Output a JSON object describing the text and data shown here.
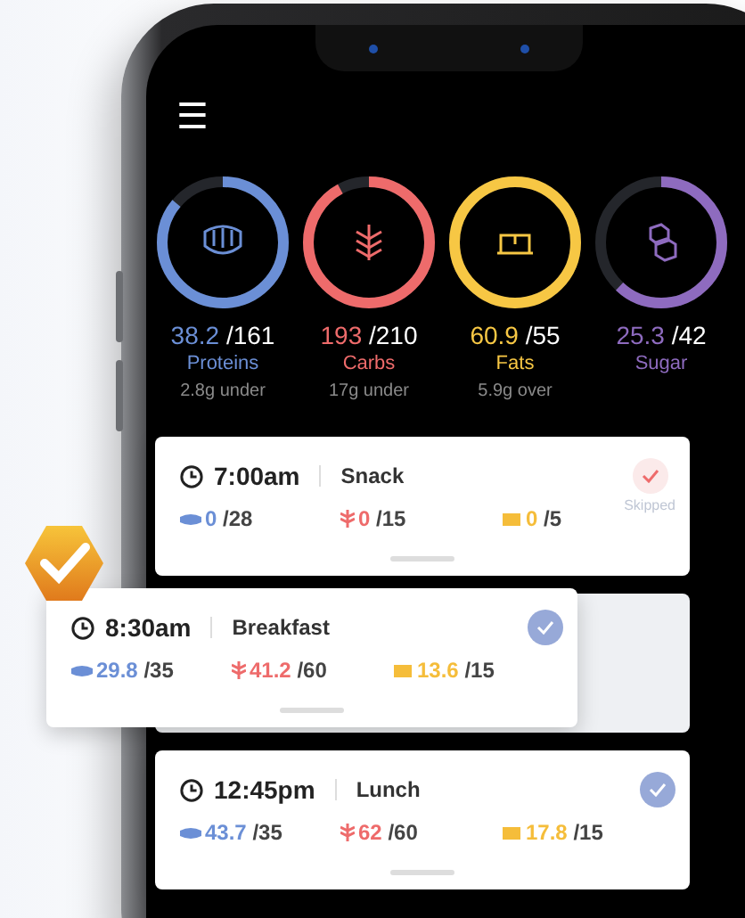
{
  "menu": {
    "label": "☰"
  },
  "macros": [
    {
      "kind": "protein",
      "value": "38.2",
      "goal": "/161",
      "name": "Proteins",
      "note": "2.8g under",
      "level": 0.86,
      "color": "#6b8fd6"
    },
    {
      "kind": "carbs",
      "value": "193",
      "goal": "/210",
      "name": "Carbs",
      "note": "17g under",
      "level": 0.92,
      "color": "#ee6b6b"
    },
    {
      "kind": "fat",
      "value": "60.9",
      "goal": "/55",
      "name": "Fats",
      "note": "5.9g over",
      "level": 1,
      "color": "#f7c744"
    },
    {
      "kind": "sugar",
      "value": "25.3",
      "goal": "/42",
      "name": "Sugar",
      "level": 0.62,
      "color": "#8e6bbf"
    }
  ],
  "meals": [
    {
      "time": "7:00am",
      "name": "Snack",
      "checked": true,
      "skipped": true,
      "status_label": "Skipped",
      "popped": false,
      "amounts": [
        {
          "kind": "protein",
          "value": "0",
          "goal": "/28"
        },
        {
          "kind": "carbs",
          "value": "0",
          "goal": "/15"
        },
        {
          "kind": "fat",
          "value": "0",
          "goal": "/5"
        }
      ]
    },
    {
      "time": "8:30am",
      "name": "Breakfast",
      "checked": true,
      "skipped": false,
      "popped": true,
      "amounts": [
        {
          "kind": "protein",
          "value": "29.8",
          "goal": "/35"
        },
        {
          "kind": "carbs",
          "value": "41.2",
          "goal": "/60"
        },
        {
          "kind": "fat",
          "value": "13.6",
          "goal": "/15"
        }
      ]
    },
    {
      "time": "12:45pm",
      "name": "Lunch",
      "checked": true,
      "skipped": false,
      "popped": false,
      "amounts": [
        {
          "kind": "protein",
          "value": "43.7",
          "goal": "/35"
        },
        {
          "kind": "carbs",
          "value": "62",
          "goal": "/60"
        },
        {
          "kind": "fat",
          "value": "17.8",
          "goal": "/15"
        }
      ]
    }
  ]
}
